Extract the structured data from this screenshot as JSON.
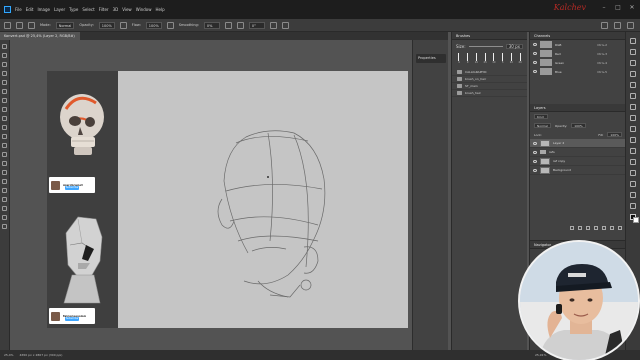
{
  "menu": {
    "items": [
      "File",
      "Edit",
      "Image",
      "Layer",
      "Type",
      "Select",
      "Filter",
      "3D",
      "View",
      "Window",
      "Help"
    ],
    "signature": "Kalchev",
    "win_controls": [
      "–",
      "□",
      "✕"
    ]
  },
  "options": {
    "mode_label": "Mode:",
    "mode_value": "Normal",
    "opacity_label": "Opacity:",
    "opacity_value": "100%",
    "flow_label": "Flow:",
    "flow_value": "100%",
    "smoothing_label": "Smoothing:",
    "smoothing_value": "0%",
    "angle_value": "0°"
  },
  "document": {
    "tab_title": "Konvert.psd @ 25,4% (Layer 2, RGB/8#) *",
    "tab_close": "×"
  },
  "references": {
    "card1": {
      "channel": "marcbrunet",
      "button": "Subscribe"
    },
    "card2": {
      "channel": "falconsession",
      "button": "Subscribe"
    }
  },
  "properties": {
    "label": "Properties"
  },
  "brushes": {
    "title": "Brushes",
    "size_label": "Size:",
    "size_value": "30 px",
    "presets": [
      "4",
      "9",
      "10",
      "25",
      "10",
      "5",
      "20",
      "20"
    ],
    "folders": [
      "CALLIGRAPHIC",
      "brush_on_hair",
      "ST_main",
      "brush_hair"
    ]
  },
  "channels": {
    "title": "Channels",
    "rows": [
      {
        "name": "RGB",
        "shortcut": "Ctrl+2"
      },
      {
        "name": "Red",
        "shortcut": "Ctrl+3"
      },
      {
        "name": "Green",
        "shortcut": "Ctrl+4"
      },
      {
        "name": "Blue",
        "shortcut": "Ctrl+5"
      }
    ]
  },
  "layers": {
    "title": "Layers",
    "kind_label": "Kind",
    "blend_mode": "Normal",
    "opacity_label": "Opacity:",
    "opacity_value": "100%",
    "lock_label": "Lock:",
    "fill_label": "Fill:",
    "fill_value": "100%",
    "rows": [
      {
        "name": "Layer 2",
        "type": "layer",
        "selected": true
      },
      {
        "name": "refs",
        "type": "folder",
        "selected": false
      },
      {
        "name": "ref copy",
        "type": "layer",
        "selected": false
      },
      {
        "name": "Background",
        "type": "layer",
        "selected": false
      }
    ]
  },
  "navigator": {
    "title": "Navigator"
  },
  "status": {
    "zoom": "25,4%",
    "doc_info": "4650 px x 2867 px (300 ppi)",
    "zoom_right": "25,91%"
  },
  "colors": {
    "accent": "#31a8ff",
    "signature": "#b52a25",
    "canvas": "#c5c5c5"
  }
}
